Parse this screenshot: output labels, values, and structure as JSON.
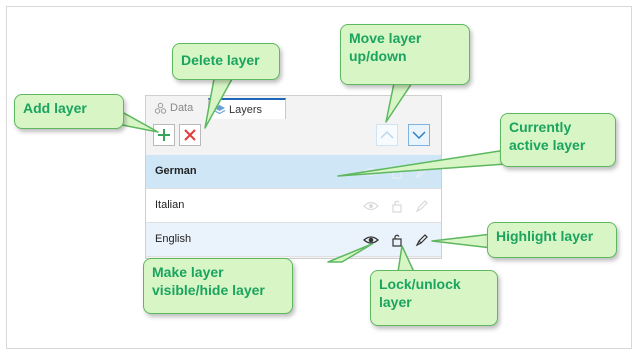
{
  "panel": {
    "tabs": [
      {
        "label": "Data",
        "icon": "data-icon",
        "active": false
      },
      {
        "label": "Layers",
        "icon": "layers-icon",
        "active": true
      }
    ],
    "toolbar": {
      "add_icon": "plus-icon",
      "delete_icon": "x-icon",
      "up_icon": "chevron-up-icon",
      "down_icon": "chevron-down-icon"
    },
    "layers": [
      {
        "name": "German",
        "state": "active"
      },
      {
        "name": "Italian",
        "state": "normal"
      },
      {
        "name": "English",
        "state": "highlighted"
      }
    ]
  },
  "callouts": {
    "add_layer": "Add layer",
    "delete_layer": "Delete layer",
    "move_layer_1": "Move layer",
    "move_layer_2": "up/down",
    "currently_active_1": "Currently",
    "currently_active_2": "active layer",
    "highlight_layer": "Highlight layer",
    "visible_1": "Make layer",
    "visible_2": "visible/hide layer",
    "lock_1": "Lock/unlock",
    "lock_2": "layer"
  },
  "colors": {
    "callout_fill": "#d8f5c6",
    "callout_border": "#5db85f",
    "callout_text": "#1aa45e",
    "active_row": "#cfe6f7",
    "add_green": "#3aa35a",
    "delete_red": "#e23b3b",
    "tab_accent": "#1e66b8"
  }
}
